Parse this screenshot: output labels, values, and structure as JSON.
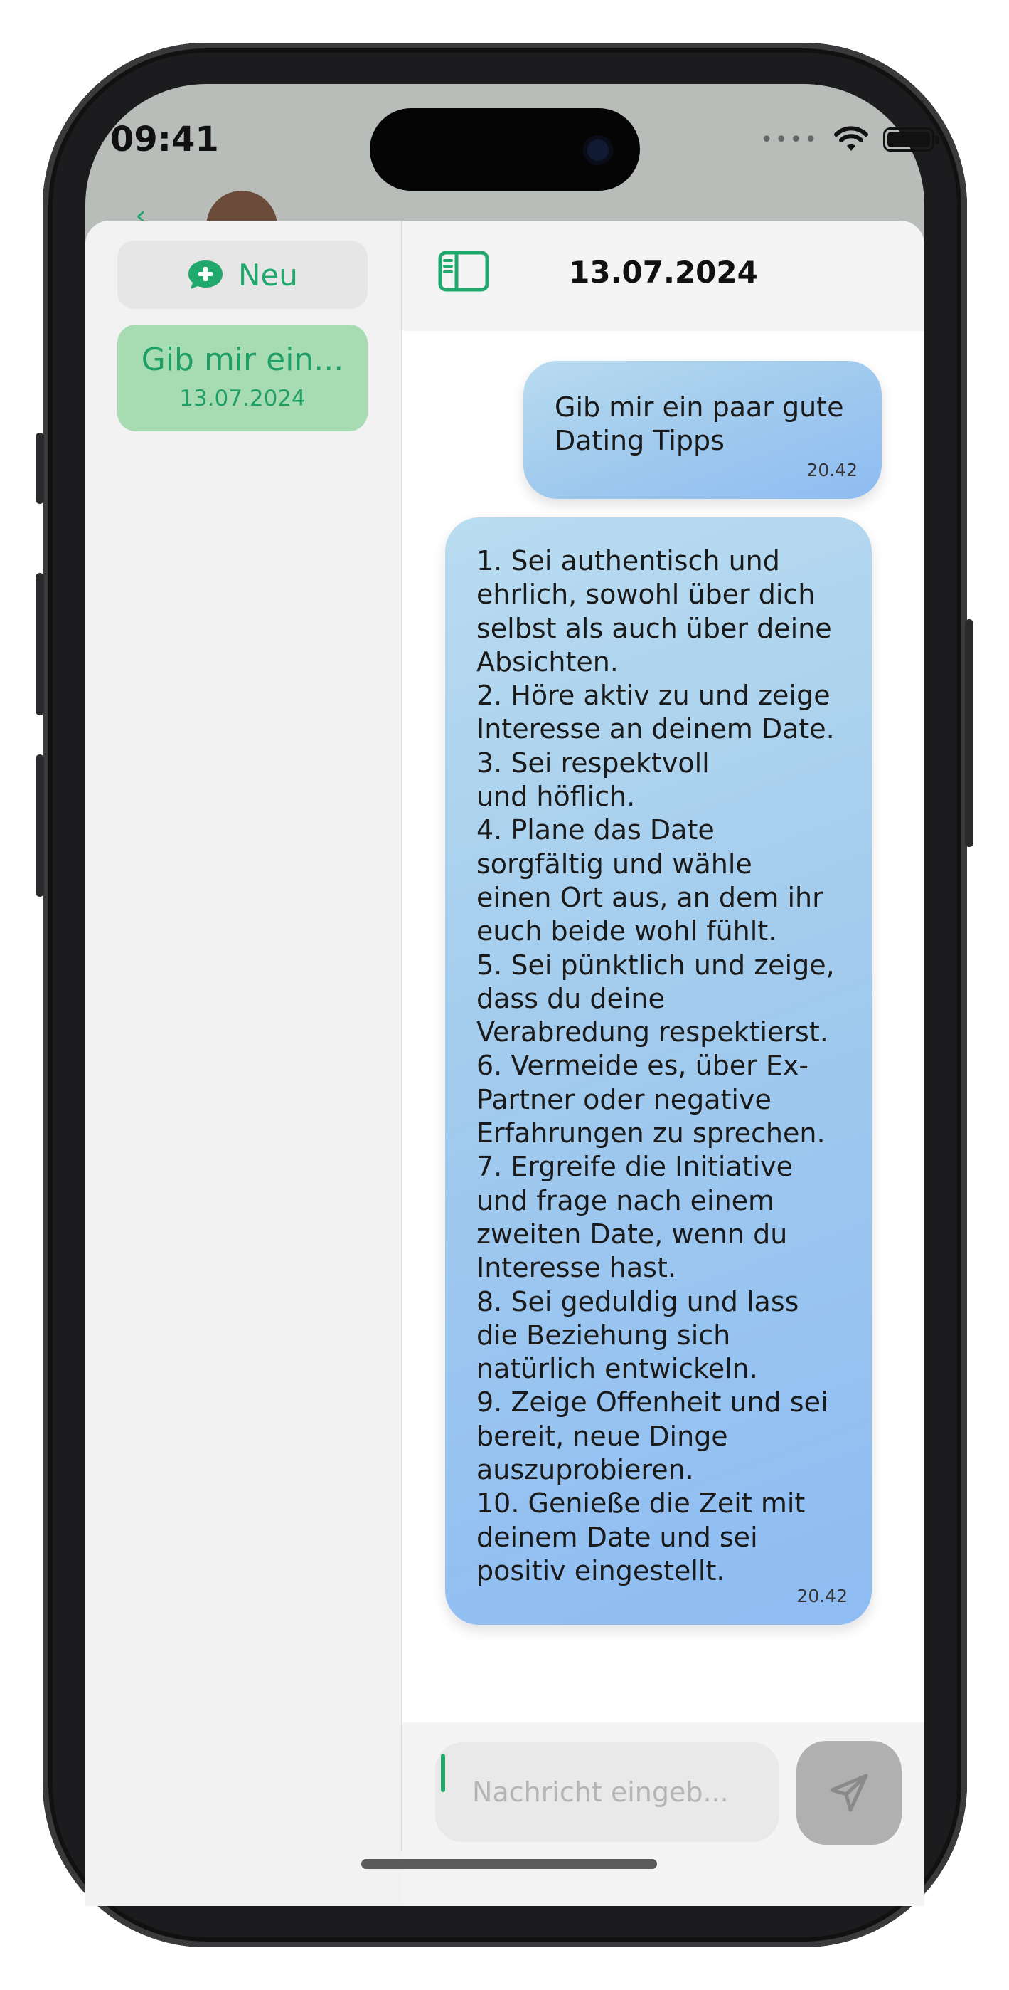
{
  "status_bar": {
    "time": "09:41"
  },
  "sidebar": {
    "new_button_label": "Neu",
    "conversations": [
      {
        "title": "Gib mir ein...",
        "date": "13.07.2024"
      }
    ]
  },
  "header": {
    "title": "13.07.2024"
  },
  "messages": [
    {
      "role": "user",
      "text": "Gib mir ein paar gute\nDating Tipps",
      "time": "20.42"
    },
    {
      "role": "assistant",
      "text": "1. Sei authentisch und\nehrlich, sowohl über dich\nselbst als auch über deine\nAbsichten.\n2. Höre aktiv zu und zeige\nInteresse an deinem Date.\n3. Sei respektvoll\nund höflich.\n4. Plane das Date\nsorgfältig und wähle\neinen Ort aus, an dem ihr\neuch beide wohl fühlt.\n5. Sei pünktlich und zeige,\ndass du deine\nVerabredung respektierst.\n6. Vermeide es, über Ex-\nPartner oder negative\nErfahrungen zu sprechen.\n7. Ergreife die Initiative\nund frage nach einem\nzweiten Date, wenn du\nInteresse hast.\n8. Sei geduldig und lass\ndie Beziehung sich\nnatürlich entwickeln.\n9. Zeige Offenheit und sei\nbereit, neue Dinge\nauszuprobieren.\n10. Genieße die Zeit mit\ndeinem Date und sei\npositiv eingestellt.",
      "time": "20.42"
    }
  ],
  "input": {
    "placeholder": "Nachricht eingeb..."
  },
  "colors": {
    "accent": "#21a86d",
    "conversation_selected": "#a7dbb1",
    "bubble_gradient_start": "#b9dcf0",
    "bubble_gradient_end": "#8ebcf3",
    "send_button_disabled": "#b0b0b0"
  },
  "icons": {
    "new_chat": "chat-plus-icon",
    "sidebar_toggle": "sidebar-toggle-icon",
    "send": "paper-plane-icon",
    "wifi": "wifi-icon",
    "battery": "battery-icon"
  }
}
